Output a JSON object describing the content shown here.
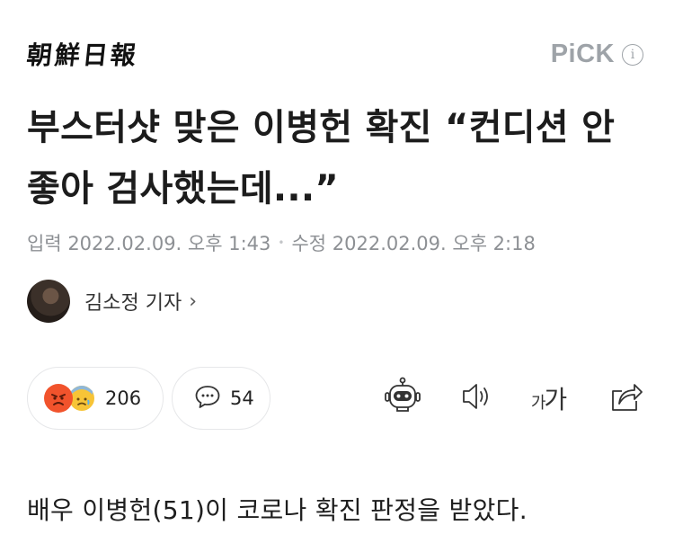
{
  "header": {
    "logo_text": "朝鮮日報",
    "pick_label": "PiCK",
    "info_glyph": "i"
  },
  "article": {
    "headline": "부스터샷 맞은 이병헌 확진 “컨디션 안 좋아 검사했는데...”",
    "published": "입력 2022.02.09. 오후 1:43",
    "modified": "수정 2022.02.09. 오후 2:18",
    "date_separator": "•",
    "reporter": "김소정 기자",
    "reporter_chevron": "›",
    "first_paragraph": "배우 이병헌(51)이 코로나 확진 판정을 받았다."
  },
  "actions": {
    "reaction_count": "206",
    "comment_count": "54",
    "font_small": "가",
    "font_large": "가",
    "icons": [
      "angry-emoji-icon",
      "sad-emoji-icon",
      "comment-icon",
      "robot-summary-icon",
      "speaker-icon",
      "font-size-icon",
      "share-icon"
    ]
  },
  "colors": {
    "text": "#1c1c1c",
    "muted": "#8d9094",
    "pick": "#9ea3a8",
    "angry": "#f1532c",
    "sad": "#f7c437",
    "pill_border": "#e6e7e9"
  }
}
